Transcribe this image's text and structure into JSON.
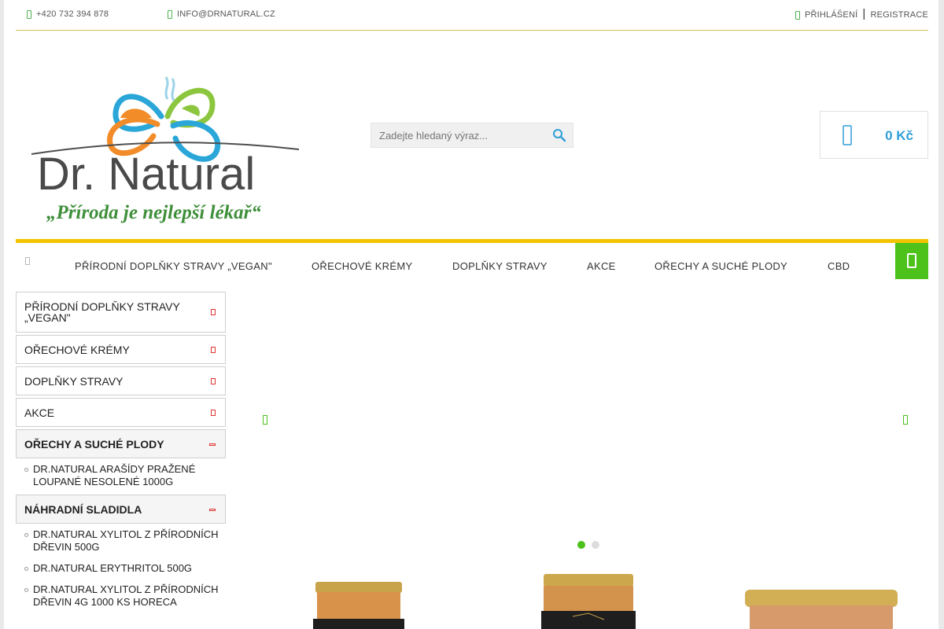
{
  "topbar": {
    "phone": "+420 732 394 878",
    "email": "INFO@DRNATURAL.CZ",
    "login": "PŘIHLÁŠENÍ",
    "separator": "|",
    "register": "REGISTRACE"
  },
  "logo": {
    "brand": "Dr. Natural",
    "slogan": "„Příroda je nejlepší lékař“"
  },
  "search": {
    "placeholder": "Zadejte hledaný výraz..."
  },
  "cart": {
    "total": "0 Kč"
  },
  "nav": {
    "items": [
      "PŘÍRODNÍ DOPLŇKY STRAVY „VEGAN\"",
      "OŘECHOVÉ KRÉMY",
      "DOPLŇKY STRAVY",
      "AKCE",
      "OŘECHY A SUCHÉ PLODY",
      "CBD"
    ]
  },
  "sidebar": {
    "categories": [
      {
        "label": "PŘÍRODNÍ DOPLŇKY STRAVY „VEGAN\""
      },
      {
        "label": "OŘECHOVÉ KRÉMY"
      },
      {
        "label": "DOPLŇKY STRAVY"
      },
      {
        "label": "AKCE"
      },
      {
        "label": "OŘECHY A SUCHÉ PLODY",
        "items": [
          "DR.NATURAL ARAŠÍDY PRAŽENÉ LOUPANÉ NESOLENÉ 1000G"
        ]
      },
      {
        "label": "NÁHRADNÍ SLADIDLA",
        "items": [
          "DR.NATURAL XYLITOL Z PŘÍRODNÍCH DŘEVIN 500G",
          "DR.NATURAL ERYTHRITOL 500G",
          "DR.NATURAL XYLITOL Z PŘÍRODNÍCH DŘEVIN 4G 1000 KS HORECA"
        ]
      }
    ]
  },
  "colors": {
    "accent_green": "#4cc21a",
    "accent_yellow": "#f2c300",
    "price_blue": "#2e9fd9"
  },
  "slider": {
    "active_slide": 1,
    "slide_count": 2
  }
}
